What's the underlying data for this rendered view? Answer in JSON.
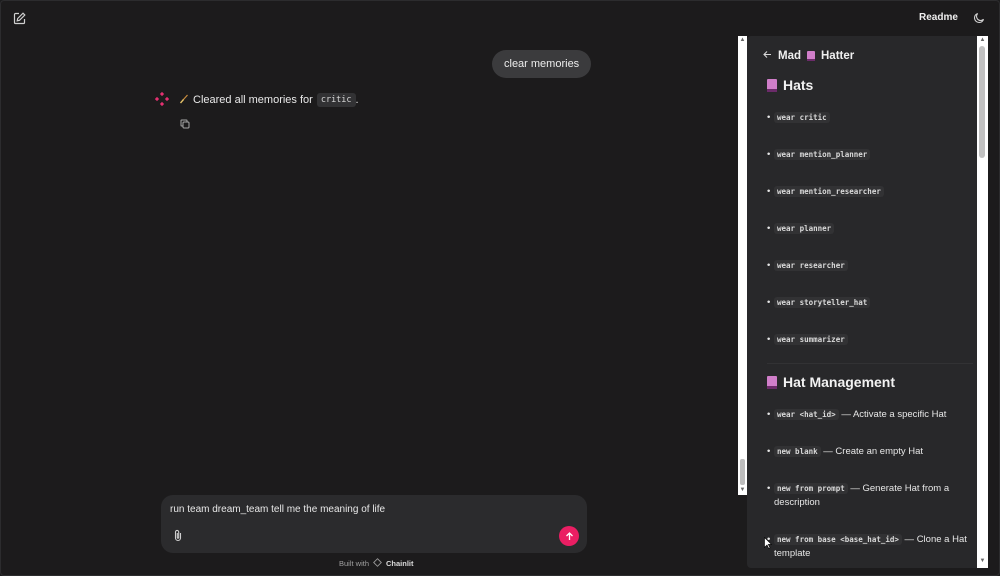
{
  "topbar": {
    "new_chat_icon": "edit-square-icon",
    "readme_label": "Readme",
    "theme_icon": "moon-icon"
  },
  "chat": {
    "user_message": "clear memories",
    "assistant": {
      "prefix_icon": "broom",
      "text_before": "Cleared all memories for",
      "code": "critic",
      "text_after": "."
    }
  },
  "composer": {
    "input_value": "run team dream_team tell me the meaning of life",
    "attach_icon": "paperclip-icon",
    "send_icon": "arrow-up-icon",
    "built_with": "Built with",
    "brand": "Chainlit"
  },
  "panel": {
    "back_icon": "arrow-left-icon",
    "title_left": "Mad",
    "title_right": "Hatter",
    "hats_heading": "Hats",
    "hats": [
      {
        "code": "wear critic"
      },
      {
        "code": "wear mention_planner"
      },
      {
        "code": "wear mention_researcher"
      },
      {
        "code": "wear planner"
      },
      {
        "code": "wear researcher"
      },
      {
        "code": "wear storyteller_hat"
      },
      {
        "code": "wear summarizer"
      }
    ],
    "management_heading": "Hat Management",
    "management": [
      {
        "code": "wear <hat_id>",
        "desc": " — Activate a specific Hat"
      },
      {
        "code": "new blank",
        "desc": " — Create an empty Hat"
      },
      {
        "code": "new from prompt",
        "desc": " — Generate Hat from a description"
      },
      {
        "code": "new from base <base_hat_id>",
        "desc": " — Clone a Hat template"
      }
    ]
  },
  "colors": {
    "accent": "#ea1e63",
    "background": "#1c1b1c",
    "panel": "#28282a"
  }
}
